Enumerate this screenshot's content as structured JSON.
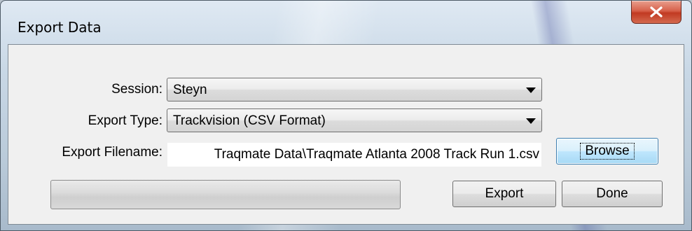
{
  "window": {
    "title": "Export Data"
  },
  "titlebar": {
    "close_icon": "close-icon"
  },
  "form": {
    "session_label": "Session:",
    "session_value": "Steyn",
    "export_type_label": "Export Type:",
    "export_type_value": "Trackvision (CSV Format)",
    "filename_label": "Export Filename:",
    "filename_value": "Traqmate Data\\Traqmate Atlanta 2008 Track Run 1.csv"
  },
  "buttons": {
    "browse": "Browse",
    "export": "Export",
    "done": "Done"
  },
  "progress": {
    "value": 0
  },
  "colors": {
    "close_button": "#c83c26",
    "default_button_border": "#3c7fb1",
    "client_background": "#f0f0f0"
  }
}
